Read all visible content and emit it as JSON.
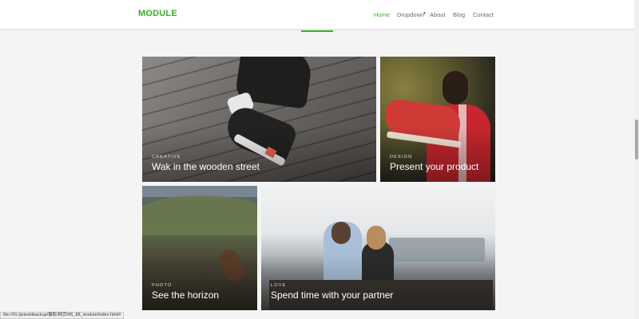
{
  "brand": "MODULE",
  "nav": {
    "home": "Home",
    "dropdown": "Dropdown",
    "about": "About",
    "blog": "Blog",
    "contact": "Contact"
  },
  "cards": [
    {
      "category": "CREATIVE",
      "title": "Wak in the wooden street"
    },
    {
      "category": "DESIGN",
      "title": "Present your product"
    },
    {
      "category": "PHOTO",
      "title": "See the horizon"
    },
    {
      "category": "LOVE",
      "title": "Spend time with your partner"
    }
  ],
  "status_url": "file:///G:/jixieshibackup/摄影/网页/ft5_88_module/index.html#",
  "colors": {
    "accent": "#3bab2a",
    "background": "#f4f4f4"
  }
}
